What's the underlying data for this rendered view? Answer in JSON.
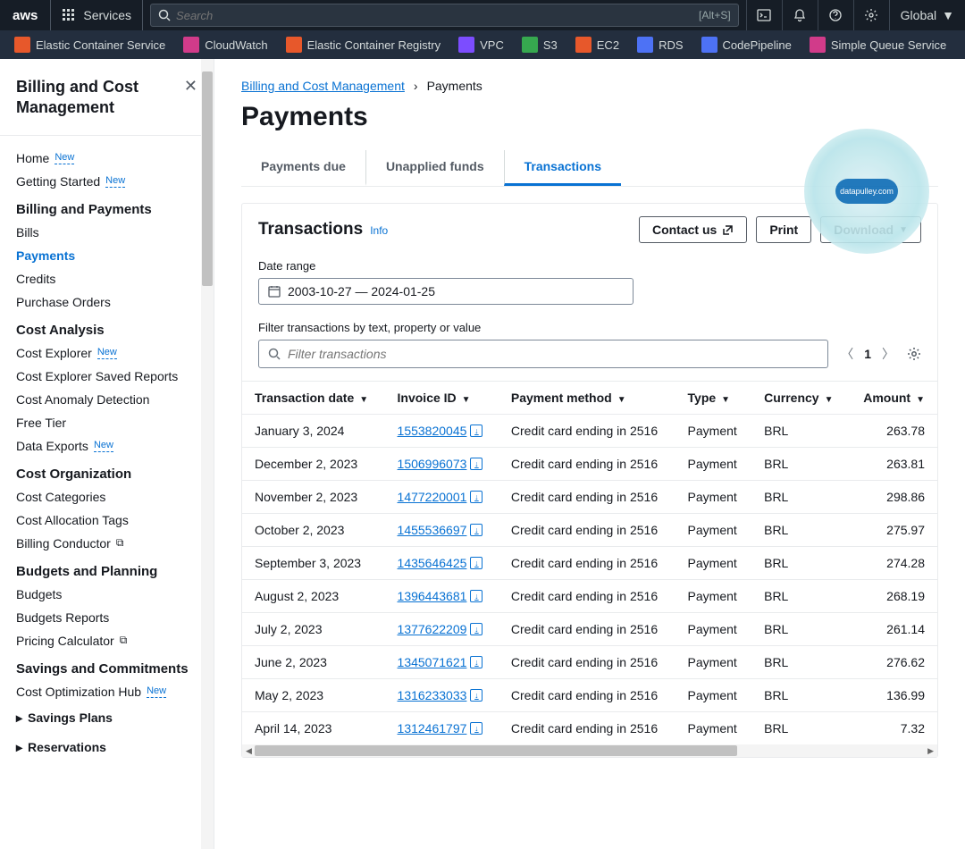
{
  "topnav": {
    "logo": "aws",
    "services": "Services",
    "search_placeholder": "Search",
    "search_alt": "[Alt+S]",
    "region": "Global"
  },
  "svcbar": [
    {
      "label": "Elastic Container Service",
      "color": "#e7582b"
    },
    {
      "label": "CloudWatch",
      "color": "#d13b8a"
    },
    {
      "label": "Elastic Container Registry",
      "color": "#e7582b"
    },
    {
      "label": "VPC",
      "color": "#7c4dff"
    },
    {
      "label": "S3",
      "color": "#36a84f"
    },
    {
      "label": "EC2",
      "color": "#e7582b"
    },
    {
      "label": "RDS",
      "color": "#4d72f5"
    },
    {
      "label": "CodePipeline",
      "color": "#4d72f5"
    },
    {
      "label": "Simple Queue Service",
      "color": "#d13b8a"
    }
  ],
  "sidebar": {
    "title": "Billing and Cost Management",
    "items": [
      {
        "type": "link",
        "label": "Home",
        "new": true
      },
      {
        "type": "link",
        "label": "Getting Started",
        "new": true
      },
      {
        "type": "heading",
        "label": "Billing and Payments"
      },
      {
        "type": "link",
        "label": "Bills"
      },
      {
        "type": "link",
        "label": "Payments",
        "active": true
      },
      {
        "type": "link",
        "label": "Credits"
      },
      {
        "type": "link",
        "label": "Purchase Orders"
      },
      {
        "type": "heading",
        "label": "Cost Analysis"
      },
      {
        "type": "link",
        "label": "Cost Explorer",
        "new": true
      },
      {
        "type": "link",
        "label": "Cost Explorer Saved Reports"
      },
      {
        "type": "link",
        "label": "Cost Anomaly Detection"
      },
      {
        "type": "link",
        "label": "Free Tier"
      },
      {
        "type": "link",
        "label": "Data Exports",
        "new": true
      },
      {
        "type": "heading",
        "label": "Cost Organization"
      },
      {
        "type": "link",
        "label": "Cost Categories"
      },
      {
        "type": "link",
        "label": "Cost Allocation Tags"
      },
      {
        "type": "link",
        "label": "Billing Conductor",
        "ext": true
      },
      {
        "type": "heading",
        "label": "Budgets and Planning"
      },
      {
        "type": "link",
        "label": "Budgets"
      },
      {
        "type": "link",
        "label": "Budgets Reports"
      },
      {
        "type": "link",
        "label": "Pricing Calculator",
        "ext": true
      },
      {
        "type": "heading",
        "label": "Savings and Commitments"
      },
      {
        "type": "link",
        "label": "Cost Optimization Hub",
        "new": true
      },
      {
        "type": "expand",
        "label": "Savings Plans"
      },
      {
        "type": "expand",
        "label": "Reservations"
      }
    ]
  },
  "breadcrumb": {
    "root": "Billing and Cost Management",
    "page": "Payments"
  },
  "title": "Payments",
  "tabs": [
    {
      "label": "Payments due"
    },
    {
      "label": "Unapplied funds"
    },
    {
      "label": "Transactions",
      "active": true
    }
  ],
  "card": {
    "title": "Transactions",
    "info": "Info",
    "contact": "Contact us",
    "print": "Print",
    "download": "Download",
    "date_label": "Date range",
    "date_value": "2003-10-27 — 2024-01-25",
    "filter_label": "Filter transactions by text, property or value",
    "filter_placeholder": "Filter transactions",
    "page": "1"
  },
  "columns": [
    "Transaction date",
    "Invoice ID",
    "Payment method",
    "Type",
    "Currency",
    "Amount"
  ],
  "rows": [
    {
      "date": "January 3, 2024",
      "inv": "1553820045",
      "method": "Credit card ending in 2516",
      "type": "Payment",
      "cur": "BRL",
      "amt": "263.78"
    },
    {
      "date": "December 2, 2023",
      "inv": "1506996073",
      "method": "Credit card ending in 2516",
      "type": "Payment",
      "cur": "BRL",
      "amt": "263.81"
    },
    {
      "date": "November 2, 2023",
      "inv": "1477220001",
      "method": "Credit card ending in 2516",
      "type": "Payment",
      "cur": "BRL",
      "amt": "298.86"
    },
    {
      "date": "October 2, 2023",
      "inv": "1455536697",
      "method": "Credit card ending in 2516",
      "type": "Payment",
      "cur": "BRL",
      "amt": "275.97"
    },
    {
      "date": "September 3, 2023",
      "inv": "1435646425",
      "method": "Credit card ending in 2516",
      "type": "Payment",
      "cur": "BRL",
      "amt": "274.28"
    },
    {
      "date": "August 2, 2023",
      "inv": "1396443681",
      "method": "Credit card ending in 2516",
      "type": "Payment",
      "cur": "BRL",
      "amt": "268.19"
    },
    {
      "date": "July 2, 2023",
      "inv": "1377622209",
      "method": "Credit card ending in 2516",
      "type": "Payment",
      "cur": "BRL",
      "amt": "261.14"
    },
    {
      "date": "June 2, 2023",
      "inv": "1345071621",
      "method": "Credit card ending in 2516",
      "type": "Payment",
      "cur": "BRL",
      "amt": "276.62"
    },
    {
      "date": "May 2, 2023",
      "inv": "1316233033",
      "method": "Credit card ending in 2516",
      "type": "Payment",
      "cur": "BRL",
      "amt": "136.99"
    },
    {
      "date": "April 14, 2023",
      "inv": "1312461797",
      "method": "Credit card ending in 2516",
      "type": "Payment",
      "cur": "BRL",
      "amt": "7.32"
    }
  ],
  "watermark": "datapulley.com"
}
